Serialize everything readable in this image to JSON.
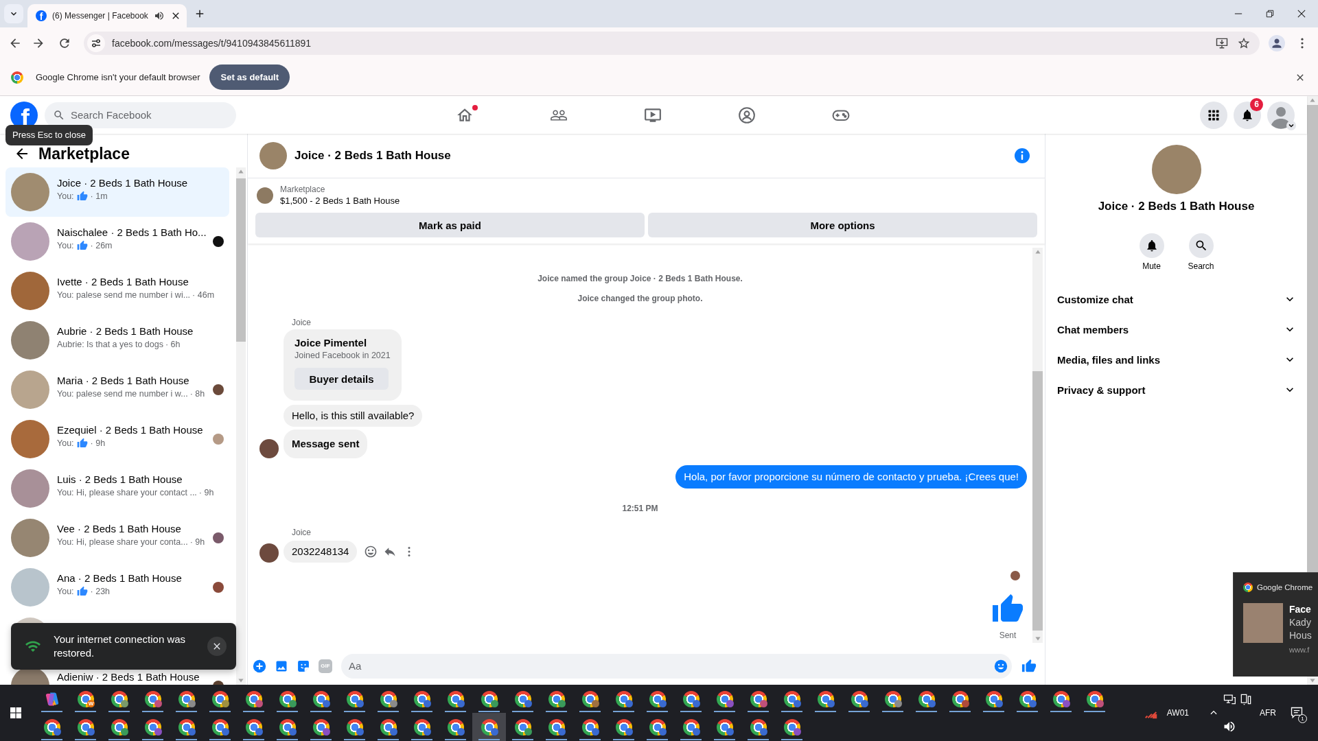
{
  "browser": {
    "tabs": [
      {
        "favicon_letter": "f",
        "title": "(6) Messenger | Facebook",
        "audio": true,
        "selected": true
      }
    ],
    "url": "facebook.com/messages/t/9410943845611891"
  },
  "default_browser_bar": {
    "message": "Google Chrome isn't your default browser",
    "button": "Set as default"
  },
  "facebook_header": {
    "logo_letter": "f",
    "search": {
      "placeholder": "Search Facebook"
    },
    "nav": [
      {
        "kind": "home",
        "selected": false,
        "dot": true
      },
      {
        "kind": "friends",
        "selected": false,
        "dot": false
      },
      {
        "kind": "video",
        "selected": false,
        "dot": false
      },
      {
        "kind": "groups",
        "selected": false,
        "dot": false
      },
      {
        "kind": "gaming",
        "selected": false,
        "dot": false
      }
    ],
    "notification_count": "6"
  },
  "tooltip": {
    "text": "Press Esc to close"
  },
  "sidebar": {
    "title": "Marketplace",
    "conversations": [
      {
        "name": "Joice · 2 Beds 1 Bath House",
        "color": "#a08c70",
        "preview": "You:",
        "like": true,
        "time": "· 1m",
        "selected": true
      },
      {
        "name": "Naischalee · 2 Beds 1 Bath Ho...",
        "color": "#b9a3b5",
        "preview": "You:",
        "like": true,
        "time": "· 26m",
        "selected": false,
        "seen_by": {
          "color": "#111111"
        }
      },
      {
        "name": "Ivette · 2 Beds 1 Bath House",
        "color": "#a0673a",
        "preview": "You: palese send me number i wi...",
        "like": false,
        "time": "· 46m",
        "selected": false
      },
      {
        "name": "Aubrie · 2 Beds 1 Bath House",
        "color": "#8f8272",
        "preview": "Aubrie: Is that a yes to dogs",
        "like": false,
        "time": "· 6h",
        "selected": false
      },
      {
        "name": "Maria · 2 Beds 1 Bath House",
        "color": "#b8a58e",
        "preview": "You: palese send me number i w...",
        "like": false,
        "time": "· 8h",
        "selected": false,
        "seen_by": {
          "color": "#6b4a3a"
        }
      },
      {
        "name": "Ezequiel · 2 Beds 1 Bath House",
        "color": "#a86a3c",
        "preview": "You:",
        "like": true,
        "time": "· 9h",
        "selected": false,
        "seen_by": {
          "color": "#b59a86"
        }
      },
      {
        "name": "Luis · 2 Beds 1 Bath House",
        "color": "#a89098",
        "preview": "You: Hi, please share your contact ...",
        "like": false,
        "time": "· 9h",
        "selected": false
      },
      {
        "name": "Vee · 2 Beds 1 Bath House",
        "color": "#968672",
        "preview": "You: Hi, please share your conta...",
        "like": false,
        "time": "· 9h",
        "selected": false,
        "seen_by": {
          "color": "#7a5a6a"
        }
      },
      {
        "name": "Ana · 2 Beds 1 Bath House",
        "color": "#b8c4cc",
        "preview": "You:",
        "like": true,
        "time": "· 23h",
        "selected": false,
        "seen_by": {
          "color": "#8a4a3a"
        }
      },
      {
        "color": "#d0c8c0",
        "selected": false
      },
      {
        "name": "Adieniw · 2 Beds 1 Bath House",
        "color": "#8a7a6a",
        "selected": false,
        "seen_by": {
          "color": "#5a4030"
        }
      }
    ]
  },
  "connection_toast": {
    "message": "Your internet connection was restored."
  },
  "chat": {
    "title": "Joice · 2 Beds 1 Bath House",
    "listing": {
      "label": "Marketplace",
      "title": "$1,500 - 2 Beds 1 Bath House"
    },
    "actions": [
      "Mark as paid",
      "More options"
    ],
    "messages": [
      {
        "kind": "system",
        "text": "Joice named the group Joice · 2 Beds 1 Bath House."
      },
      {
        "kind": "system",
        "text": "Joice changed the group photo."
      },
      {
        "kind": "sender",
        "text": "Joice"
      },
      {
        "kind": "profile_card",
        "name": "Joice Pimentel",
        "detail": "Joined Facebook in 2021",
        "button": "Buyer details"
      },
      {
        "kind": "incoming",
        "text": "Hello, is this still available?",
        "avatar": false,
        "bold": false,
        "hovered": false
      },
      {
        "kind": "incoming",
        "text": "Message sent",
        "avatar": true,
        "bold": true,
        "hovered": false
      },
      {
        "kind": "outgoing",
        "text": "Hola, por favor proporcione su número de contacto y prueba. ¡Crees que!"
      },
      {
        "kind": "timestamp",
        "text": "12:51 PM"
      },
      {
        "kind": "sender",
        "text": "Joice"
      },
      {
        "kind": "incoming",
        "text": "2032248134",
        "avatar": true,
        "bold": false,
        "hovered": true
      },
      {
        "kind": "seen"
      },
      {
        "kind": "like",
        "status": "Sent"
      }
    ],
    "composer": {
      "gif_label": "GIF",
      "placeholder": "Aa"
    }
  },
  "details_panel": {
    "title": "Joice · 2 Beds 1 Bath House",
    "actions": [
      {
        "kind": "mute",
        "label": "Mute"
      },
      {
        "kind": "search",
        "label": "Search"
      }
    ],
    "sections": [
      {
        "label": "Customize chat",
        "expanded": false
      },
      {
        "label": "Chat members",
        "expanded": false
      },
      {
        "label": "Media, files and links",
        "expanded": false
      },
      {
        "label": "Privacy & support",
        "expanded": false
      }
    ]
  },
  "system_notification": {
    "app": "Google Chrome",
    "title": "Face",
    "lines": [
      "Kady",
      "Hous"
    ],
    "source": "www.f"
  },
  "taskbar": {
    "rows": [
      [
        {
          "kind": "copilot",
          "selected": false
        },
        {
          "kind": "browser",
          "color": "#e8710a",
          "badge_text": "W",
          "selected": false
        },
        {
          "kind": "browser",
          "color": "#7a9a6a",
          "selected": false
        },
        {
          "kind": "browser",
          "color": "#c0507a",
          "selected": false
        },
        {
          "kind": "browser",
          "color": "#8a8a8a",
          "selected": false
        },
        {
          "kind": "browser",
          "color": "#a09040",
          "selected": false
        },
        {
          "kind": "browser",
          "color": "#c0507a",
          "selected": false
        },
        {
          "kind": "browser",
          "color": "#3a9a5a",
          "selected": false
        },
        {
          "kind": "browser",
          "color": "#3a6ad0",
          "selected": false
        },
        {
          "kind": "browser",
          "color": "#3a6ad0",
          "selected": false
        },
        {
          "kind": "browser",
          "color": "#8a8a8a",
          "selected": false
        },
        {
          "kind": "browser",
          "color": "#3a6ad0",
          "selected": false
        },
        {
          "kind": "browser",
          "color": "#3a6ad0",
          "selected": false
        },
        {
          "kind": "browser",
          "color": "#3a9a5a",
          "selected": false
        },
        {
          "kind": "browser",
          "color": "#3a6ad0",
          "selected": false
        },
        {
          "kind": "browser",
          "color": "#3a9a5a",
          "selected": false
        },
        {
          "kind": "browser",
          "color": "#a07040",
          "selected": false
        },
        {
          "kind": "browser",
          "color": "#3a6ad0",
          "selected": false
        },
        {
          "kind": "browser",
          "color": "#3a6ad0",
          "selected": false
        },
        {
          "kind": "browser",
          "color": "#3a6ad0",
          "selected": false
        },
        {
          "kind": "browser",
          "color": "#8a50c0",
          "selected": false
        },
        {
          "kind": "browser",
          "color": "#c0507a",
          "selected": false
        },
        {
          "kind": "browser",
          "color": "#3a6ad0",
          "selected": false
        },
        {
          "kind": "browser",
          "color": "#3a6ad0",
          "selected": false
        },
        {
          "kind": "browser",
          "color": "#3a6ad0",
          "selected": false
        },
        {
          "kind": "browser",
          "color": "#8a8a8a",
          "selected": false
        },
        {
          "kind": "browser",
          "color": "#3a6ad0",
          "selected": false
        },
        {
          "kind": "browser",
          "color": "#b04a3a",
          "selected": false
        },
        {
          "kind": "browser",
          "color": "#3a6ad0",
          "selected": false
        },
        {
          "kind": "browser",
          "color": "#3a6ad0",
          "selected": false
        },
        {
          "kind": "browser",
          "color": "#8a50c0",
          "selected": false
        },
        {
          "kind": "browser",
          "color": "#c0507a",
          "selected": false
        }
      ],
      [
        {
          "kind": "browser",
          "color": "#3a6ad0",
          "selected": false
        },
        {
          "kind": "browser",
          "color": "#3a6ad0",
          "selected": false
        },
        {
          "kind": "browser",
          "color": "#3a9a5a",
          "selected": false
        },
        {
          "kind": "browser",
          "color": "#8a50c0",
          "selected": false
        },
        {
          "kind": "browser",
          "color": "#3a6ad0",
          "selected": false
        },
        {
          "kind": "browser",
          "color": "#3a6ad0",
          "selected": false
        },
        {
          "kind": "browser",
          "color": "#3a6ad0",
          "selected": false
        },
        {
          "kind": "browser",
          "color": "#3a6ad0",
          "selected": false
        },
        {
          "kind": "browser",
          "color": "#8a50c0",
          "selected": false
        },
        {
          "kind": "browser",
          "color": "#3a6ad0",
          "selected": false
        },
        {
          "kind": "browser",
          "color": "#3a6ad0",
          "selected": false
        },
        {
          "kind": "browser",
          "color": "#3a6ad0",
          "selected": false
        },
        {
          "kind": "browser",
          "color": "#3a6ad0",
          "selected": false
        },
        {
          "kind": "browser",
          "color": "#3a6ad0",
          "selected": true
        },
        {
          "kind": "browser",
          "color": "#3a9a5a",
          "selected": false
        },
        {
          "kind": "browser",
          "color": "#3a6ad0",
          "selected": false
        },
        {
          "kind": "browser",
          "color": "#3a6ad0",
          "selected": false
        },
        {
          "kind": "browser",
          "color": "#3a6ad0",
          "selected": false
        },
        {
          "kind": "browser",
          "color": "#3a6ad0",
          "selected": false
        },
        {
          "kind": "browser",
          "color": "#3a6ad0",
          "selected": false
        },
        {
          "kind": "browser",
          "color": "#3a6ad0",
          "selected": false
        },
        {
          "kind": "browser",
          "color": "#3a6ad0",
          "selected": false
        },
        {
          "kind": "browser",
          "color": "#8a50c0",
          "selected": false
        }
      ]
    ],
    "tray": {
      "network_label": "AW01",
      "language": "AFR",
      "notification_count": "1"
    }
  }
}
